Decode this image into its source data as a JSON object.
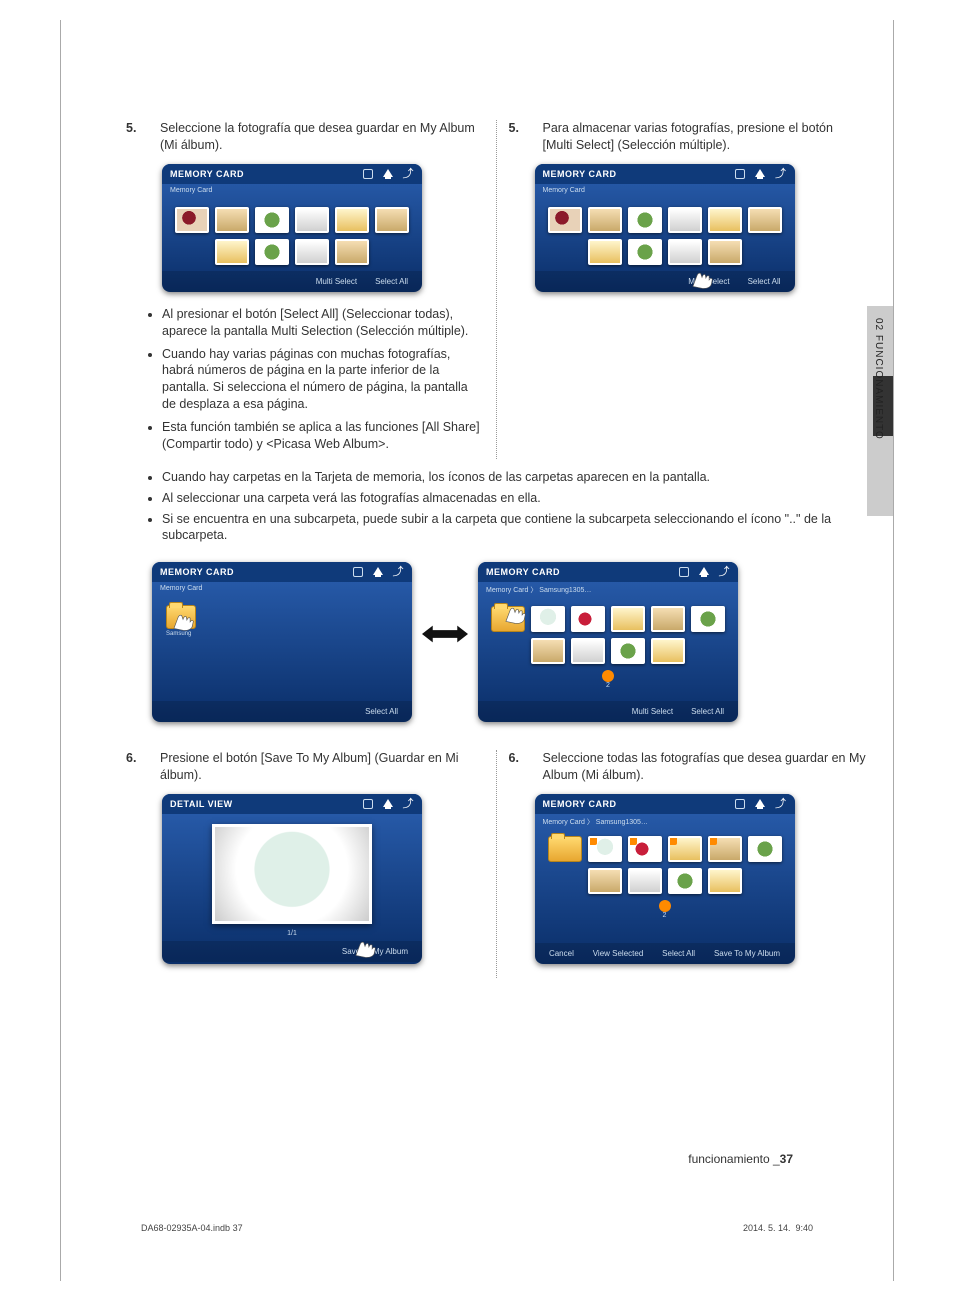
{
  "side_tab": {
    "label": "02  FUNCIONAMIENTO"
  },
  "left": {
    "step5_num": "5.",
    "step5_text": "Seleccione la fotografía que desea guardar en My Album (Mi álbum).",
    "bullets": [
      "Al presionar el botón [Select All] (Seleccionar todas), aparece la pantalla Multi Selection (Selección múltiple).",
      "Cuando hay varias páginas con muchas fotografías, habrá números de página en la parte inferior de la pantalla. Si selecciona el número de página, la pantalla de desplaza a esa página.",
      "Esta función también se aplica a las funciones [All Share] (Compartir todo) y <Picasa Web Album>."
    ],
    "step6_num": "6.",
    "step6_text": "Presione el botón [Save To My Album] (Guardar en Mi álbum)."
  },
  "right": {
    "step5_num": "5.",
    "step5_text": "Para almacenar varias fotografías, presione el botón [Multi Select] (Selección múltiple).",
    "step6_num": "6.",
    "step6_text": "Seleccione todas las fotografías que desea guardar en My Album (Mi álbum)."
  },
  "full_bullets": [
    "Cuando hay carpetas en la Tarjeta de memoria, los íconos de las carpetas aparecen en la pantalla.",
    "Al seleccionar una carpeta verá las fotografías almacenadas en ella.",
    "Si se encuentra en una subcarpeta, puede subir a la carpeta que contiene la subcarpeta seleccionando el ícono \"..\" de la subcarpeta."
  ],
  "shots": {
    "memory_card_title": "MEMORY CARD",
    "crumb1": "Memory Card",
    "crumb2": "Memory Card  〉 Samsung1305…",
    "multi_select": "Multi Select",
    "select_all": "Select All",
    "detail_view_title": "DETAIL VIEW",
    "page_1_1": "1/1",
    "save_to": "Save To My Album",
    "page_2": "2",
    "cancel": "Cancel",
    "view_selected": "View Selected",
    "folder_label": "Samsung"
  },
  "footer": {
    "section": "funcionamiento _",
    "page": "37"
  },
  "print": {
    "file": "DA68-02935A-04.indb   37",
    "date": "2014. 5. 14.   \u0019\u0019 9:40"
  }
}
